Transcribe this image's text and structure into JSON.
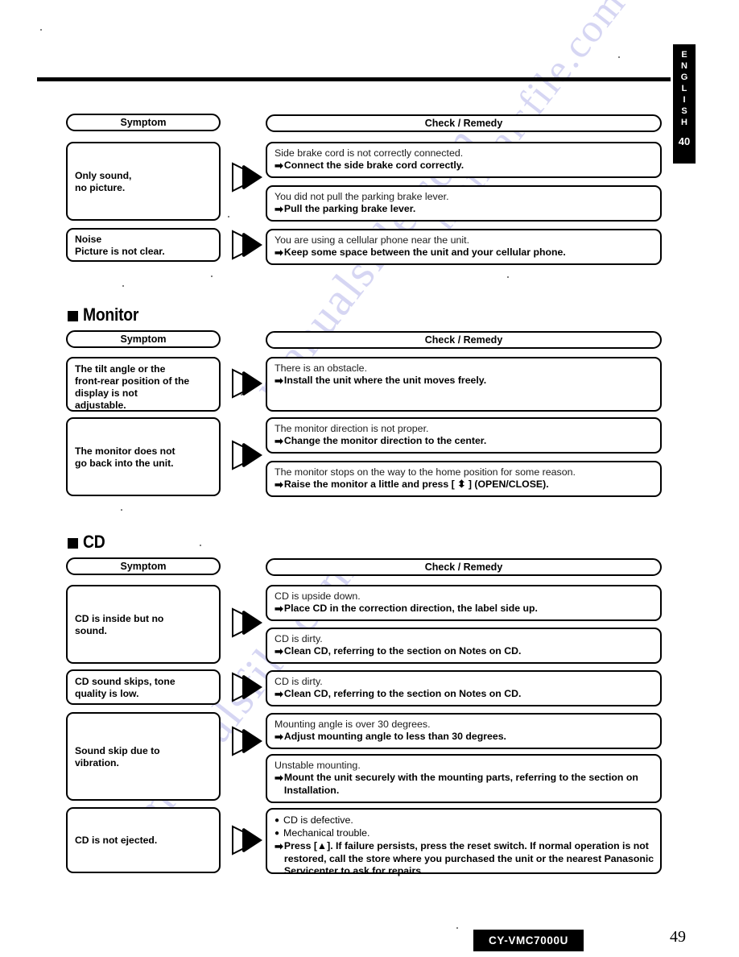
{
  "side_tab": {
    "language_chars": [
      "E",
      "N",
      "G",
      "L",
      "I",
      "S",
      "H"
    ],
    "page_label": "40"
  },
  "footer": {
    "model": "CY-VMC7000U",
    "page_number": "49"
  },
  "watermark": {
    "text": "manualsfile.com"
  },
  "headers": {
    "symptom": "Symptom",
    "check_remedy": "Check / Remedy"
  },
  "icons": {
    "arrow_right": "➡",
    "bullet_dot": "●",
    "section_square": "black-square"
  },
  "sections": [
    {
      "id": "top-continued",
      "title": null,
      "rows": [
        {
          "symptom": "Only sound,\nno picture.",
          "remedies": [
            {
              "cause": "Side brake cord is not correctly connected.",
              "fix": "Connect the side brake cord correctly."
            },
            {
              "cause": "You did not pull the parking brake lever.",
              "fix": "Pull the parking brake lever."
            }
          ]
        },
        {
          "symptom": "Noise\nPicture is not clear.",
          "remedies": [
            {
              "cause": "You are using a cellular phone near the unit.",
              "fix": "Keep some space between the unit and your cellular phone."
            }
          ]
        }
      ]
    },
    {
      "id": "monitor",
      "title": "Monitor",
      "rows": [
        {
          "symptom": "The tilt angle or the\nfront-rear position of the\ndisplay is not\nadjustable.",
          "remedies": [
            {
              "cause": "There is an obstacle.",
              "fix": "Install the unit where the unit moves freely."
            }
          ]
        },
        {
          "symptom": "The monitor does not\ngo back into the unit.",
          "remedies": [
            {
              "cause": "The monitor direction is not proper.",
              "fix": "Change the monitor direction to the center."
            },
            {
              "cause": "The monitor stops on the way to the home position for some reason.",
              "fix": "Raise the monitor a little and press [ ⬍ ] (OPEN/CLOSE)."
            }
          ]
        }
      ]
    },
    {
      "id": "cd",
      "title": "CD",
      "rows": [
        {
          "symptom": "CD is inside but no\nsound.",
          "remedies": [
            {
              "cause": "CD is upside down.",
              "fix": "Place CD in the correction direction, the label side up."
            },
            {
              "cause": "CD is dirty.",
              "fix": "Clean CD, referring to the section on Notes on CD."
            }
          ]
        },
        {
          "symptom": "CD sound skips, tone\nquality is low.",
          "remedies": [
            {
              "cause": "CD is dirty.",
              "fix": "Clean CD, referring to the section on Notes on CD."
            }
          ]
        },
        {
          "symptom": "Sound skip due to\nvibration.",
          "remedies": [
            {
              "cause": "Mounting angle is over 30 degrees.",
              "fix": "Adjust mounting angle to less than 30 degrees."
            },
            {
              "cause": "Unstable mounting.",
              "fix": "Mount the unit securely with the mounting parts, referring to the section on Installation."
            }
          ]
        },
        {
          "symptom": "CD is not ejected.",
          "remedies": [
            {
              "bullets": [
                "CD is defective.",
                "Mechanical trouble."
              ],
              "fix": "Press [▲]. If failure persists, press the reset switch. If normal operation is not restored, call the store where you purchased the unit or the nearest Panasonic Servicenter to ask for repairs."
            }
          ]
        }
      ]
    }
  ]
}
